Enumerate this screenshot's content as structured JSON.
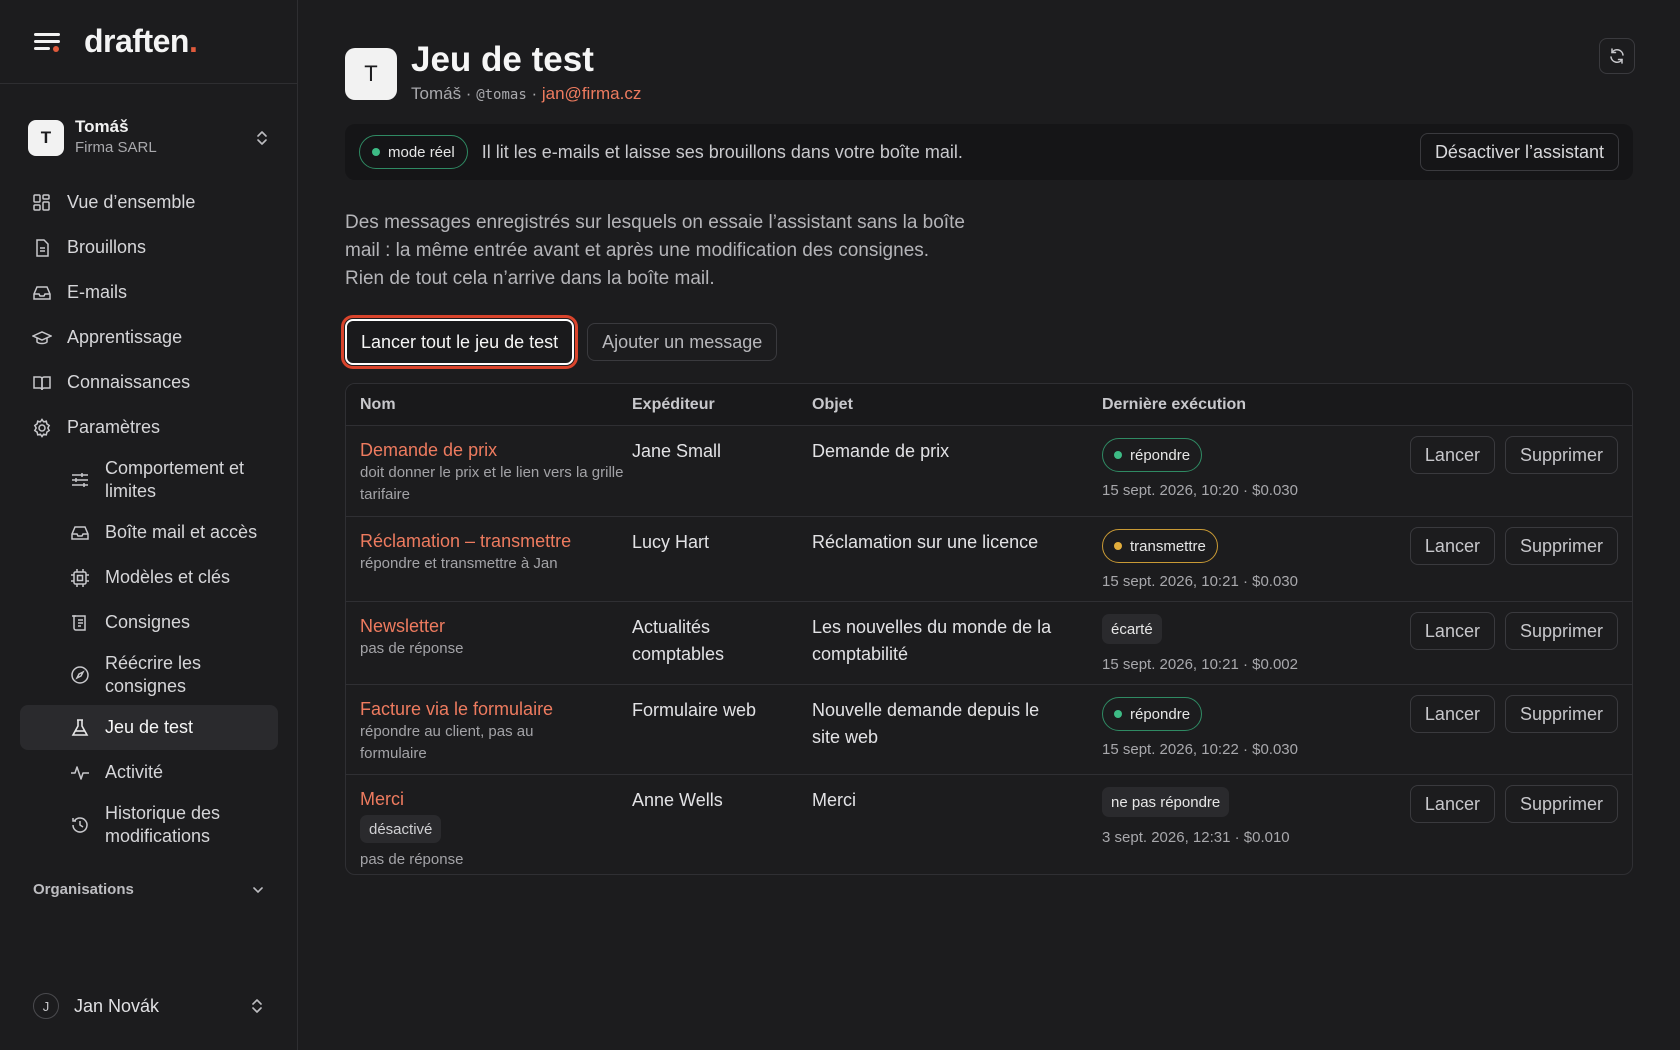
{
  "brand": {
    "name": "draften",
    "dot": "."
  },
  "workspace": {
    "initial": "T",
    "name": "Tomáš",
    "org": "Firma SARL"
  },
  "nav": {
    "overview": "Vue d’ensemble",
    "drafts": "Brouillons",
    "emails": "E-mails",
    "learning": "Apprentissage",
    "knowledge": "Connaissances",
    "settings": "Paramètres",
    "behavior": "Comportement et limites",
    "mailbox": "Boîte mail et accès",
    "models": "Modèles et clés",
    "instructions": "Consignes",
    "rewrite": "Réécrire les consignes",
    "testset": "Jeu de test",
    "activity": "Activité",
    "history": "Historique des modifications"
  },
  "organisations_label": "Organisations",
  "user": {
    "initial": "J",
    "name": "Jan Novák"
  },
  "page": {
    "avatar": "T",
    "title": "Jeu de test",
    "sub_name": "Tomáš",
    "sep": " · ",
    "handle": "@tomas",
    "email": "jan@firma.cz"
  },
  "banner": {
    "mode": "mode réel",
    "text": "Il lit les e-mails et laisse ses brouillons dans votre boîte mail.",
    "deactivate": "Désactiver l’assistant"
  },
  "description": "Des messages enregistrés sur lesquels on essaie l’assistant sans la boîte mail : la même entrée avant et après une modification des consignes. Rien de tout cela n’arrive dans la boîte mail.",
  "actions": {
    "run_all": "Lancer tout le jeu de test",
    "add": "Ajouter un message"
  },
  "table": {
    "headers": {
      "name": "Nom",
      "sender": "Expéditeur",
      "subject": "Objet",
      "last": "Dernière exécution"
    },
    "run_label": "Lancer",
    "delete_label": "Supprimer",
    "disabled_label": "désactivé",
    "rows": [
      {
        "name": "Demande de prix",
        "note": "doit donner le prix et le lien vers la grille tarifaire",
        "sender": "Jane Small",
        "subject": "Demande de prix",
        "result": "répondre",
        "result_style": "green",
        "meta": "15 sept. 2026, 10:20 · $0.030"
      },
      {
        "name": "Réclamation – transmettre",
        "note": "répondre et transmettre à Jan",
        "sender": "Lucy Hart",
        "subject": "Réclamation sur une licence",
        "result": "transmettre",
        "result_style": "amber",
        "meta": "15 sept. 2026, 10:21 · $0.030"
      },
      {
        "name": "Newsletter",
        "note": "pas de réponse",
        "sender": "Actualités comptables",
        "subject": "Les nouvelles du monde de la comptabilité",
        "result": "écarté",
        "result_style": "plain",
        "meta": "15 sept. 2026, 10:21 · $0.002"
      },
      {
        "name": "Facture via le formulaire",
        "note": "répondre au client, pas au formulaire",
        "sender": "Formulaire web",
        "subject": "Nouvelle demande depuis le site web",
        "result": "répondre",
        "result_style": "green",
        "meta": "15 sept. 2026, 10:22 · $0.030"
      },
      {
        "name": "Merci",
        "note": "pas de réponse",
        "sender": "Anne Wells",
        "subject": "Merci",
        "result": "ne pas répondre",
        "result_style": "plain",
        "meta": "3 sept. 2026, 12:31 · $0.010"
      }
    ]
  },
  "colors": {
    "accent": "#ee7b5f",
    "brand_dot": "#e05a3c",
    "green": "#3dbb85",
    "amber": "#e2ad3c",
    "focus_ring": "#d9442c"
  }
}
